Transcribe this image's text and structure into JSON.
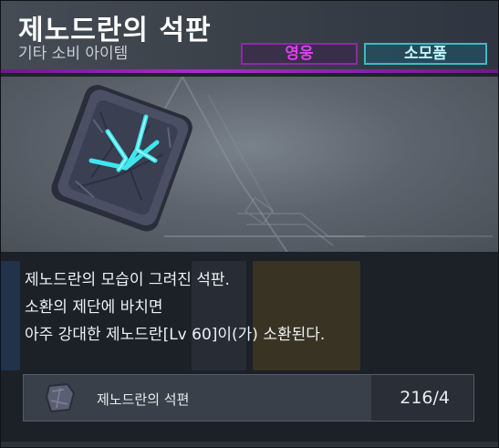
{
  "item": {
    "name": "제노드란의 석판",
    "category": "기타 소비 아이템",
    "tags": [
      "영웅",
      "소모품"
    ]
  },
  "description": [
    "제노드란의 모습이 그려진 석판.",
    "소환의 제단에 바치면",
    "아주 강대한 제노드란[Lv 60]이(가) 소환된다."
  ],
  "material": {
    "name": "제노드란의 석편",
    "count": "216/4"
  },
  "colors": {
    "hero_tag": "#e040f0",
    "consumable_tag": "#bff4ff",
    "accent_bar": "#a52fc5",
    "rune_glow": "#3fe6ee"
  },
  "icons": {
    "main": "stone-tablet-icon",
    "material": "stone-fragment-icon"
  }
}
